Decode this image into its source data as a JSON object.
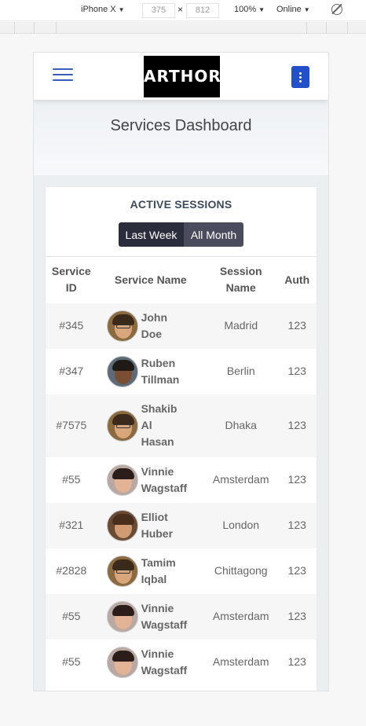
{
  "devtools": {
    "device": "iPhone X",
    "width": "375",
    "times": "×",
    "height": "812",
    "zoom": "100%",
    "network": "Online"
  },
  "navbar": {
    "logo": "ARTHOR",
    "menu_icon": "hamburger-icon",
    "options_icon": "vertical-dots-icon"
  },
  "page_title": "Services Dashboard",
  "card": {
    "title": "ACTIVE SESSIONS",
    "toggle": [
      "Last Week",
      "All Month"
    ],
    "headers": {
      "id_line1": "Service",
      "id_line2": "ID",
      "name": "Service Name",
      "session_line1": "Session",
      "session_line2": "Name",
      "auth": "Auth"
    },
    "rows": [
      {
        "id": "#345",
        "name": [
          "John",
          "Doe"
        ],
        "session": "Madrid",
        "auth": "123",
        "avatar": "man-glasses"
      },
      {
        "id": "#347",
        "name": [
          "Ruben",
          "Tillman"
        ],
        "session": "Berlin",
        "auth": "123",
        "avatar": "man-smiling"
      },
      {
        "id": "#7575",
        "name": [
          "Shakib",
          "Al",
          "Hasan"
        ],
        "session": "Dhaka",
        "auth": "123",
        "avatar": "man-glasses"
      },
      {
        "id": "#55",
        "name": [
          "Vinnie",
          "Wagstaff"
        ],
        "session": "Amsterdam",
        "auth": "123",
        "avatar": "woman"
      },
      {
        "id": "#321",
        "name": [
          "Elliot",
          "Huber"
        ],
        "session": "London",
        "auth": "123",
        "avatar": "man-beard"
      },
      {
        "id": "#2828",
        "name": [
          "Tamim",
          "Iqbal"
        ],
        "session": "Chittagong",
        "auth": "123",
        "avatar": "man-glasses"
      },
      {
        "id": "#55",
        "name": [
          "Vinnie",
          "Wagstaff"
        ],
        "session": "Amsterdam",
        "auth": "123",
        "avatar": "woman"
      },
      {
        "id": "#55",
        "name": [
          "Vinnie",
          "Wagstaff"
        ],
        "session": "Amsterdam",
        "auth": "123",
        "avatar": "woman"
      }
    ]
  }
}
